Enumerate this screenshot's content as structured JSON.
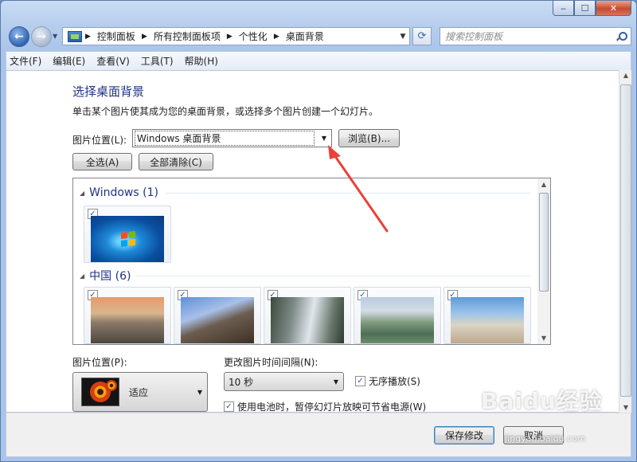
{
  "window": {
    "minimize_glyph": "‒",
    "maximize_glyph": "☐",
    "close_glyph": "✕"
  },
  "address": {
    "breadcrumbs": [
      "控制面板",
      "所有控制面板项",
      "个性化",
      "桌面背景"
    ],
    "search_placeholder": "搜索控制面板"
  },
  "menubar": {
    "items": [
      "文件(F)",
      "编辑(E)",
      "查看(V)",
      "工具(T)",
      "帮助(H)"
    ]
  },
  "main": {
    "title": "选择桌面背景",
    "description": "单击某个图片使其成为您的桌面背景，或选择多个图片创建一个幻灯片。",
    "picture_location_label": "图片位置(L):",
    "picture_location_value": "Windows 桌面背景",
    "browse_label": "浏览(B)...",
    "select_all_label": "全选(A)",
    "clear_all_label": "全部清除(C)"
  },
  "gallery": {
    "groups": [
      {
        "title": "Windows (1)",
        "count": 1
      },
      {
        "title": "中国 (6)",
        "count": 5
      }
    ],
    "checkmark": "✓"
  },
  "options": {
    "position_label": "图片位置(P):",
    "position_value": "适应",
    "interval_label": "更改图片时间间隔(N):",
    "interval_value": "10 秒",
    "shuffle_label": "无序播放(S)",
    "shuffle_checked": true,
    "battery_label": "使用电池时，暂停幻灯片放映可节省电源(W)",
    "battery_checked": true
  },
  "footer": {
    "save_label": "保存修改",
    "cancel_label": "取消"
  },
  "watermark": {
    "text": "Baidu经验",
    "sub": "jingyan.baidu.com"
  },
  "colors": {
    "accent_title": "#1e3287",
    "annotation_arrow": "#e8423a"
  }
}
